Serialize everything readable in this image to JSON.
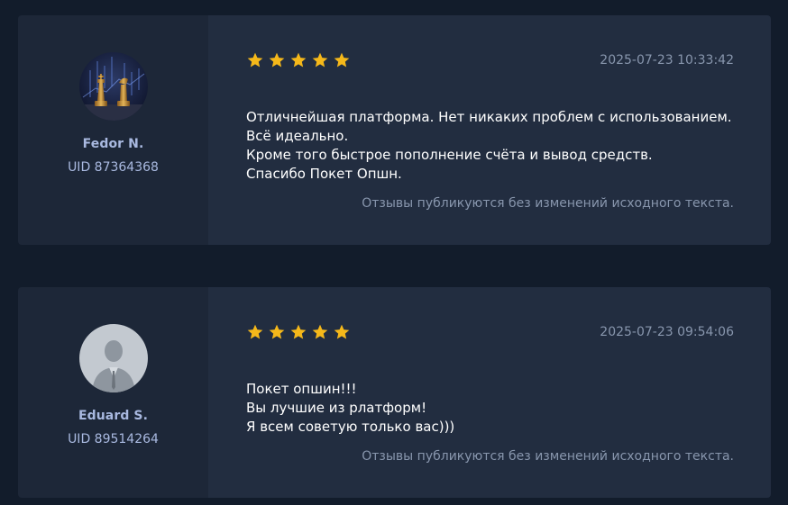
{
  "reviews": [
    {
      "name": "Fedor N.",
      "uid": "UID 87364368",
      "rating": 5,
      "date": "2025-07-23 10:33:42",
      "lines": [
        "Отличнейшая платформа. Нет никаких проблем с использованием.",
        "Всё идеально.",
        "Кроме того быстрое пополнение счёта и вывод средств.",
        "Спасибо Покет Опшн."
      ],
      "note": "Отзывы публикуются без изменений исходного текста.",
      "avatar": "chess-icon"
    },
    {
      "name": "Eduard S.",
      "uid": "UID 89514264",
      "rating": 5,
      "date": "2025-07-23 09:54:06",
      "lines": [
        "Покет опшин!!!",
        "Вы лучшие из рлатформ!",
        "Я всем советую только вас)))"
      ],
      "note": "Отзывы публикуются без изменений исходного текста.",
      "avatar": "user-silhouette-icon"
    }
  ],
  "colors": {
    "background": "#121c2b",
    "card_left": "#1d2738",
    "card_right": "#222d40",
    "star": "#f5b81a",
    "name": "#a9b9e0",
    "muted": "#8896ad"
  }
}
